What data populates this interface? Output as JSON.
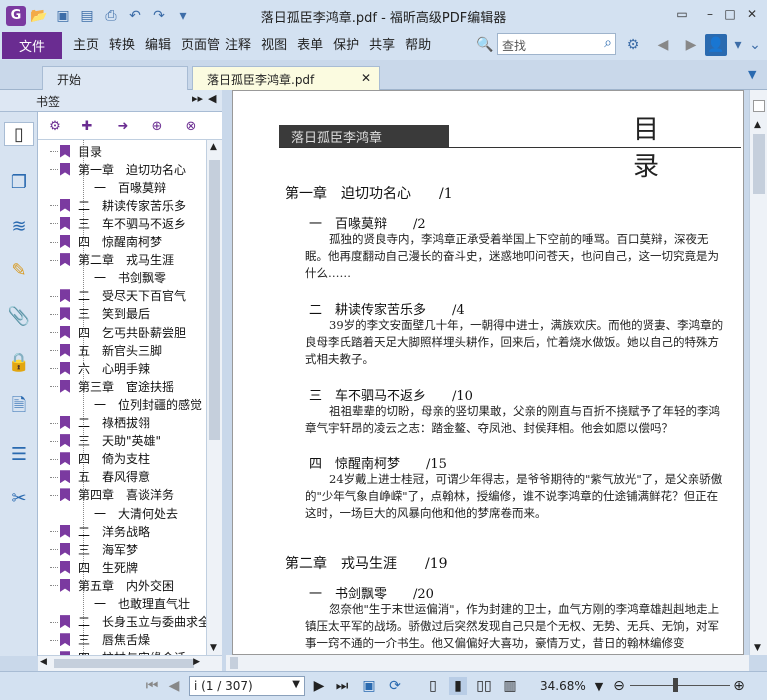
{
  "window": {
    "title": "落日孤臣李鸿章.pdf - 福昕高级PDF编辑器"
  },
  "menu": {
    "file": "文件",
    "items": [
      "主页",
      "转换",
      "编辑",
      "页面管理",
      "注释",
      "视图",
      "表单",
      "保护",
      "共享",
      "帮助"
    ]
  },
  "search": {
    "placeholder": "查找"
  },
  "tabs": [
    "开始",
    "落日孤臣李鸿章.pdf"
  ],
  "panel": {
    "title": "书签"
  },
  "bookmarks": [
    {
      "label": "目录",
      "level": 0
    },
    {
      "label": "第一章　迫切功名心",
      "level": 0
    },
    {
      "label": "一　百喙莫辩",
      "level": 1
    },
    {
      "label": "二　耕读传家苦乐多",
      "level": 0
    },
    {
      "label": "三　车不驷马不返乡",
      "level": 0
    },
    {
      "label": "四　惊醒南柯梦",
      "level": 0
    },
    {
      "label": "第二章　戎马生涯",
      "level": 0
    },
    {
      "label": "一　书剑飘零",
      "level": 1
    },
    {
      "label": "二　受尽天下百官气",
      "level": 0
    },
    {
      "label": "三　笑到最后",
      "level": 0
    },
    {
      "label": "四　乞丐共卧薪尝胆",
      "level": 0
    },
    {
      "label": "五　新官头三脚",
      "level": 0
    },
    {
      "label": "六　心明手辣",
      "level": 0
    },
    {
      "label": "第三章　宦途扶摇",
      "level": 0
    },
    {
      "label": "一　位列封疆的感觉",
      "level": 1
    },
    {
      "label": "二　祿栖拔翎",
      "level": 0
    },
    {
      "label": "三　天助\"英雄\"",
      "level": 0
    },
    {
      "label": "四　倚为支柱",
      "level": 0
    },
    {
      "label": "五　春风得意",
      "level": 0
    },
    {
      "label": "第四章　喜谈洋务",
      "level": 0
    },
    {
      "label": "一　大清何处去",
      "level": 1
    },
    {
      "label": "二　洋务战略",
      "level": 0
    },
    {
      "label": "三　海军梦",
      "level": 0
    },
    {
      "label": "四　生死牌",
      "level": 0
    },
    {
      "label": "第五章　内外交困",
      "level": 0
    },
    {
      "label": "一　也敢理直气壮",
      "level": 1
    },
    {
      "label": "二　长身玉立与委曲求全",
      "level": 0
    },
    {
      "label": "三　唇焦舌燥",
      "level": 0
    },
    {
      "label": "四　柱杖与实缘会话",
      "level": 0
    }
  ],
  "page": {
    "banner": "落日孤臣李鸿章",
    "heading": "目　录",
    "entries": [
      {
        "type": "ch",
        "text": "第一章　迫切功名心　　/1"
      },
      {
        "type": "sec",
        "text": "一　百喙莫辩　　/2"
      },
      {
        "type": "para",
        "text": "孤独的贤良寺内，李鸿章正承受着举国上下空前的唾骂。百口莫辩，深夜无眠。他再度翻动自己漫长的奋斗史，迷惑地叩问苍天，也问自己，这一切究竟是为什么……"
      },
      {
        "type": "sec",
        "text": "二　耕读传家苦乐多　　/4"
      },
      {
        "type": "para",
        "text": "39岁的李文安面壁几十年，一朝得中进士，满族欢庆。而他的贤妻、李鸿章的良母李氏踏着天足大脚照样埋头耕作，回来后，忙着烧水做饭。她以自己的特殊方式相夫教子。"
      },
      {
        "type": "sec",
        "text": "三　车不驷马不返乡　　/10"
      },
      {
        "type": "para",
        "text": "祖祖辈辈的切盼，母亲的竖切果敢，父亲的刚直与百折不挠赋予了年轻的李鸿章气宇轩昂的凌云之志：踏金鳌、夺凤池、封侯拜相。他会如愿以偿吗？"
      },
      {
        "type": "sec",
        "text": "四　惊醒南柯梦　　/15"
      },
      {
        "type": "para",
        "text": "24岁戴上进士桂冠，可谓少年得志，是爷爷期待的\"紫气放光\"了，是父亲骄傲的\"少年气象自峥嵘\"了，点翰林，授编修，谁不说李鸿章的仕途铺满鲜花？但正在这时，一场巨大的风暴向他和他的梦席卷而来。"
      },
      {
        "type": "ch",
        "text": "第二章　戎马生涯　　/19"
      },
      {
        "type": "sec",
        "text": "一　书剑飘零　　/20"
      },
      {
        "type": "para",
        "text": "忽奈他\"生于末世运偏消\"，作为封建的卫士，血气方刚的李鸿章雄赳赳地走上镇压太平军的战场。骄傲过后突然发现自己只是个无权、无势、无兵、无饷，对军事一窍不通的一介书生。他又偏偏好大喜功，豪情万丈，昔日的翰林编修变"
      }
    ]
  },
  "status": {
    "page_box": "i (1 / 307)",
    "zoom": "34.68%"
  }
}
